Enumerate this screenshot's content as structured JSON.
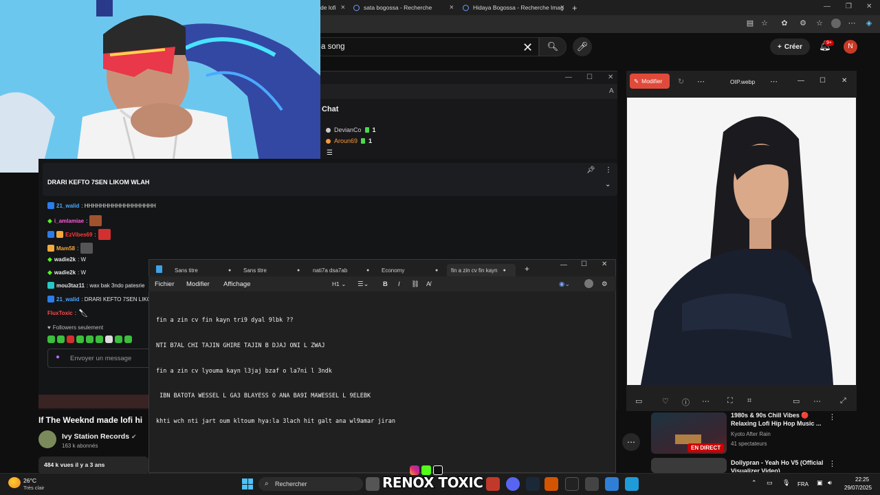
{
  "browser": {
    "tabs": [
      {
        "label": "de lofi"
      },
      {
        "label": "sata bogossa - Recherche"
      },
      {
        "label": "Hidaya Bogossa - Recherche Imag"
      }
    ],
    "new_tab": "+"
  },
  "youtube": {
    "search_value": "a song",
    "create_label": "Créer",
    "notif_badge": "9+",
    "avatar_letter": "N",
    "video_title": "If The Weeknd made lofi hi",
    "channel_name": "Ivy Station Records",
    "channel_subs": "163 k abonnés",
    "stats": "484 k vues  il y a 3 ans",
    "recommendations": [
      {
        "title": "1980s & 90s Chill Vibes 🔴 Relaxing Lofi Hip Hop Music ...",
        "channel": "Kyoto After Rain",
        "meta": "41 spectateurs",
        "badge": "EN DIRECT"
      },
      {
        "title": "Dollypran - Yeah Ho V5 (Official Visualizer Video)",
        "channel": "",
        "meta": ""
      }
    ]
  },
  "chat_window": {
    "title": "Chat",
    "viewers": [
      {
        "name": "DevianCo",
        "count": "1",
        "color": "#d0d0d0"
      },
      {
        "name": "Aroun69",
        "count": "1",
        "color": "#f59a3a"
      }
    ]
  },
  "kick_chat": {
    "pinned": "DRARI KEFTO 7SEN LIKOM WLAH",
    "messages": [
      {
        "user": "21_walid",
        "color": "#4aa8ff",
        "text": ": HHHHHHHHHHHHHHHHHH"
      },
      {
        "user": "i_amlamiae",
        "color": "#ff5bd6",
        "text": ":"
      },
      {
        "user": "EzVibes69",
        "color": "#ff3b3b",
        "text": ":"
      },
      {
        "user": "Mam58",
        "color": "#f3a93b",
        "text": ":"
      },
      {
        "user": "wadie2k",
        "color": "#ffffff",
        "text": ": W"
      },
      {
        "user": "wadie2k",
        "color": "#ffffff",
        "text": ": W"
      },
      {
        "user": "mou3taz11",
        "color": "#ffffff",
        "text": ": wax bak 3ndo patesrie"
      },
      {
        "user": "21_walid",
        "color": "#4aa8ff",
        "text": ": DRARI KEFTO 7SEN LIKO"
      },
      {
        "user": "FluxToxic",
        "color": "#ff4a4a",
        "text": ":"
      }
    ],
    "followers_only": "Followers seulement",
    "input_placeholder": "Envoyer un message"
  },
  "notepad": {
    "tabs": [
      "Sans titre",
      "Sans titre",
      "nati7a dsa7ab",
      "Economy",
      "fin a zin cv fin kayn"
    ],
    "menu": [
      "Fichier",
      "Modifier",
      "Affichage"
    ],
    "heading_select": "H1",
    "lines": [
      "fin a zin cv fin kayn tri9 dyal 9lbk ??",
      "NTI B7AL CHI TAJIN GHIRE TAJIN B DJAJ ONI L ZWAJ",
      "fin a zin cv lyouma kayn l3jaj bzaf o la7ni l 3ndk",
      " IBN BATOTA WESSEL L GA3 BLAYESS O ANA BA9I MAWESSEL L 9ELEBK",
      "khti wch nti jart oum kltoum hya:la 3lach hit galt ana wl9amar jiran"
    ]
  },
  "photo_viewer": {
    "modify_label": "Modifier",
    "file_name": "OIP.webp"
  },
  "taskbar": {
    "temp": "26°C",
    "weather": "Très clair",
    "search": "Rechercher",
    "lang": "FRA",
    "time": "22:25",
    "date": "29/07/2025"
  },
  "watermark": "RENOX TOXIC",
  "colors": {
    "accent_red": "#cc0000",
    "kick_green": "#53fc18",
    "photo_accent": "#e04a3a"
  }
}
